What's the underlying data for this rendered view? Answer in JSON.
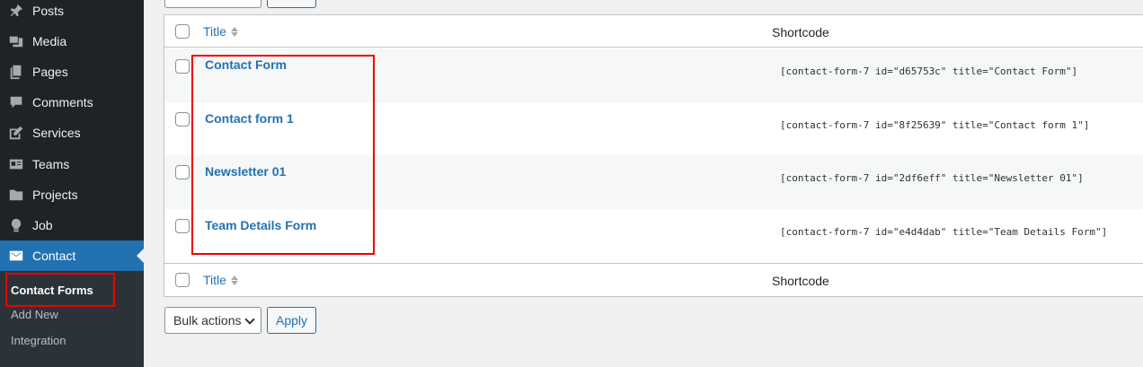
{
  "sidebar": {
    "items": [
      {
        "label": "Posts",
        "icon": "pin-icon"
      },
      {
        "label": "Media",
        "icon": "media-icon"
      },
      {
        "label": "Pages",
        "icon": "pages-icon"
      },
      {
        "label": "Comments",
        "icon": "comments-icon"
      },
      {
        "label": "Services",
        "icon": "edit-icon"
      },
      {
        "label": "Teams",
        "icon": "id-card-icon"
      },
      {
        "label": "Projects",
        "icon": "folder-icon"
      },
      {
        "label": "Job",
        "icon": "lightbulb-icon"
      },
      {
        "label": "Contact",
        "icon": "email-icon"
      }
    ],
    "active_item": "Contact",
    "submenu": [
      "Contact Forms",
      "Add New",
      "Integration"
    ],
    "current_submenu": "Contact Forms"
  },
  "table": {
    "columns": {
      "title": "Title",
      "shortcode": "Shortcode"
    },
    "rows": [
      {
        "title": "Contact Form",
        "shortcode": "[contact-form-7 id=\"d65753c\" title=\"Contact Form\"]"
      },
      {
        "title": "Contact form 1",
        "shortcode": "[contact-form-7 id=\"8f25639\" title=\"Contact form 1\"]"
      },
      {
        "title": "Newsletter 01",
        "shortcode": "[contact-form-7 id=\"2df6eff\" title=\"Newsletter 01\"]"
      },
      {
        "title": "Team Details Form",
        "shortcode": "[contact-form-7 id=\"e4d4dab\" title=\"Team Details Form\"]"
      }
    ]
  },
  "bulk_actions": {
    "label": "Bulk actions",
    "apply": "Apply"
  },
  "colors": {
    "accent": "#2271b1",
    "sidebar_bg": "#1d2327",
    "highlight": "#e00000"
  }
}
